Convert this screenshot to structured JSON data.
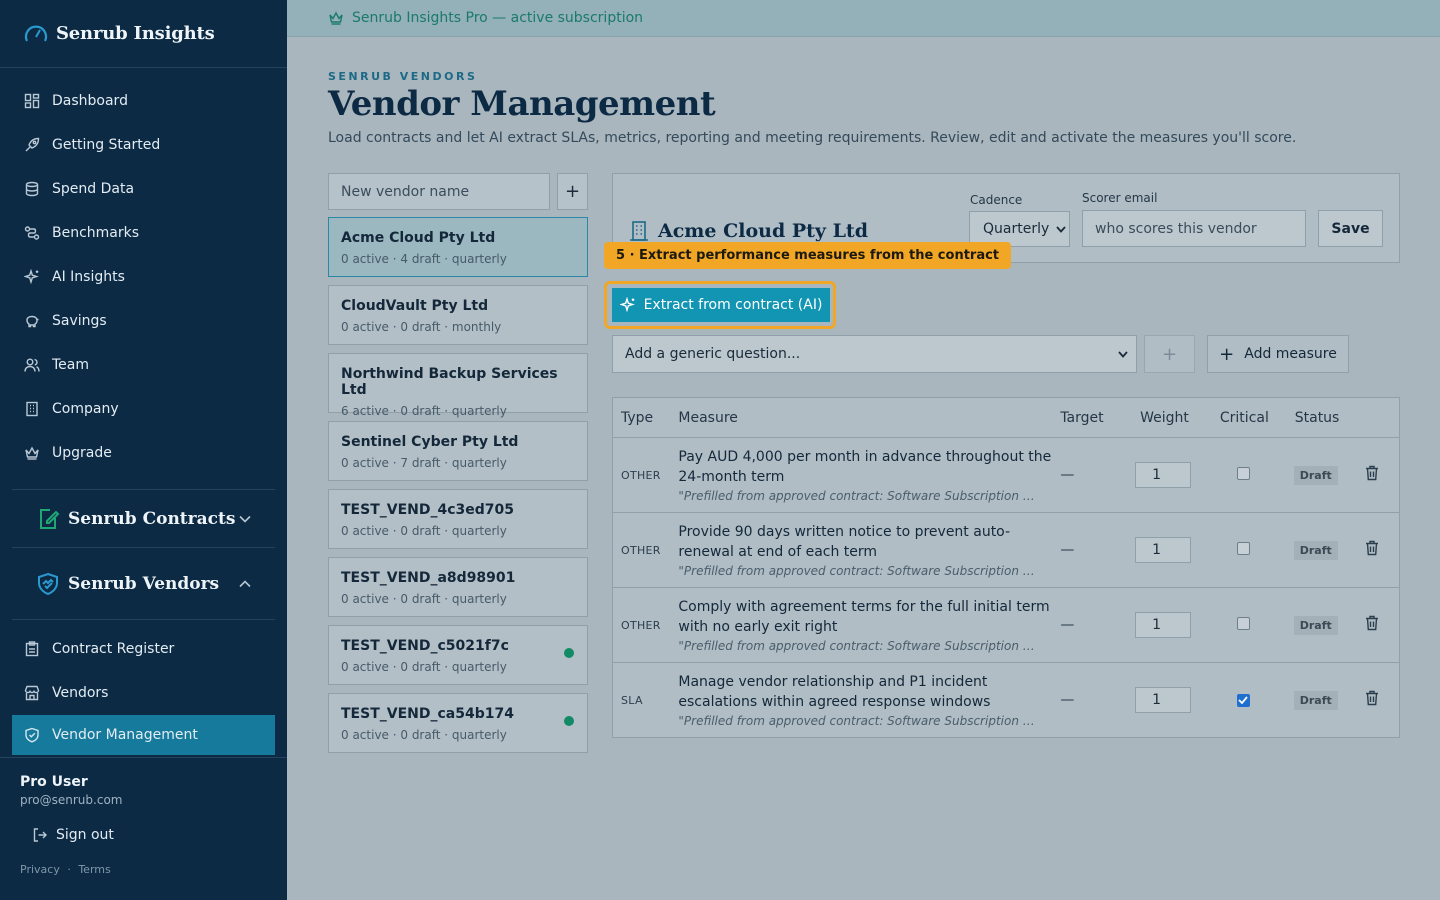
{
  "sidebar": {
    "brand": "Senrub Insights",
    "items": [
      {
        "label": "Dashboard",
        "icon": "dashboard-icon"
      },
      {
        "label": "Getting Started",
        "icon": "rocket-icon"
      },
      {
        "label": "Spend Data",
        "icon": "database-icon"
      },
      {
        "label": "Benchmarks",
        "icon": "benchmarks-icon"
      },
      {
        "label": "AI Insights",
        "icon": "sparkle-icon"
      },
      {
        "label": "Savings",
        "icon": "piggy-bank-icon"
      },
      {
        "label": "Team",
        "icon": "users-icon"
      },
      {
        "label": "Company",
        "icon": "building-icon"
      },
      {
        "label": "Upgrade",
        "icon": "crown-icon"
      }
    ],
    "sections": {
      "contracts": {
        "title": "Senrub Contracts"
      },
      "vendors": {
        "title": "Senrub Vendors",
        "items": [
          {
            "label": "Contract Register",
            "icon": "clipboard-icon"
          },
          {
            "label": "Vendors",
            "icon": "store-icon"
          },
          {
            "label": "Vendor Management",
            "icon": "shield-check-icon",
            "active": true
          }
        ]
      }
    },
    "user": {
      "name": "Pro User",
      "email": "pro@senrub.com"
    },
    "signout": "Sign out",
    "privacy": "Privacy",
    "separator": "·",
    "terms": "Terms"
  },
  "banner": {
    "text": "Senrub Insights Pro — active subscription"
  },
  "header": {
    "eyebrow": "SENRUB VENDORS",
    "title": "Vendor Management",
    "subtitle": "Load contracts and let AI extract SLAs, metrics, reporting and meeting requirements. Review, edit and activate the measures you'll score."
  },
  "new_vendor": {
    "placeholder": "New vendor name",
    "add": "+"
  },
  "vendors": [
    {
      "name": "Acme Cloud Pty Ltd",
      "meta": "0 active · 4 draft · quarterly",
      "selected": true
    },
    {
      "name": "CloudVault Pty Ltd",
      "meta": "0 active · 0 draft · monthly"
    },
    {
      "name": "Northwind Backup Services Ltd",
      "meta": "6 active · 0 draft · quarterly"
    },
    {
      "name": "Sentinel Cyber Pty Ltd",
      "meta": "0 active · 7 draft · quarterly"
    },
    {
      "name": "TEST_VEND_4c3ed705",
      "meta": "0 active · 0 draft · quarterly"
    },
    {
      "name": "TEST_VEND_a8d98901",
      "meta": "0 active · 0 draft · quarterly"
    },
    {
      "name": "TEST_VEND_c5021f7c",
      "meta": "0 active · 0 draft · quarterly",
      "dot": true
    },
    {
      "name": "TEST_VEND_ca54b174",
      "meta": "0 active · 0 draft · quarterly",
      "dot": true
    }
  ],
  "detail": {
    "vendor_name": "Acme Cloud Pty Ltd",
    "cadence_label": "Cadence",
    "cadence_value": "Quarterly",
    "scorer_label": "Scorer email",
    "scorer_placeholder": "who scores this vendor",
    "save": "Save",
    "tour_tip": "5 · Extract performance measures from the contract",
    "extract": "Extract from contract (AI)",
    "generic_placeholder": "Add a generic question...",
    "small_add": "+",
    "add_measure": "Add measure"
  },
  "table": {
    "headers": [
      "Type",
      "Measure",
      "Target",
      "Weight",
      "Critical",
      "Status"
    ],
    "rows": [
      {
        "type": "OTHER",
        "title": "Pay AUD 4,000 per month in advance throughout the 24-month term",
        "note": "\"Prefilled from approved contract: Software Subscription Agreem...",
        "target": "—",
        "weight": "1",
        "critical": false,
        "status": "Draft"
      },
      {
        "type": "OTHER",
        "title": "Provide 90 days written notice to prevent auto-renewal at end of each term",
        "note": "\"Prefilled from approved contract: Software Subscription Agreem...",
        "target": "—",
        "weight": "1",
        "critical": false,
        "status": "Draft"
      },
      {
        "type": "OTHER",
        "title": "Comply with agreement terms for the full initial term with no early exit right",
        "note": "\"Prefilled from approved contract: Software Subscription Agreem...",
        "target": "—",
        "weight": "1",
        "critical": false,
        "status": "Draft"
      },
      {
        "type": "SLA",
        "title": "Manage vendor relationship and P1 incident escalations within agreed response windows",
        "note": "\"Prefilled from approved contract: Software Subscription Agreem...",
        "target": "—",
        "weight": "1",
        "critical": true,
        "status": "Draft"
      }
    ]
  },
  "colors": {
    "sidebar": "#0c2a44",
    "accent": "#1294b3",
    "active_nav": "#167a9c",
    "tour": "#f2a625",
    "online": "#128a66"
  }
}
